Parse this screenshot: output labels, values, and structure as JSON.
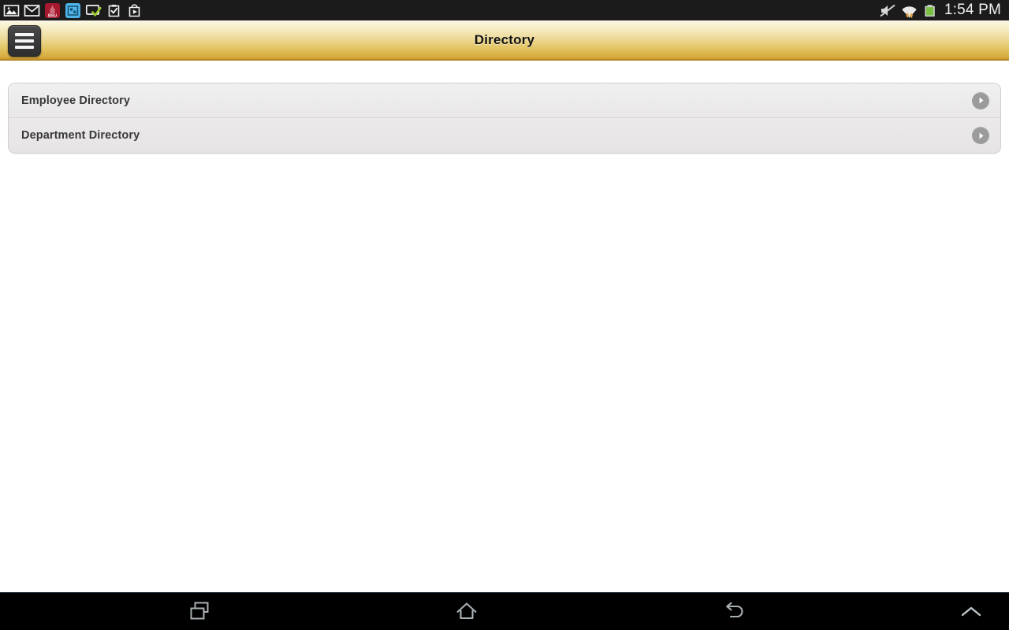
{
  "status_bar": {
    "notification_icons": [
      {
        "name": "gallery-photo-icon",
        "label": "Gallery"
      },
      {
        "name": "gmail-icon",
        "label": "Gmail"
      },
      {
        "name": "bsu-app-icon",
        "label": "BSU"
      },
      {
        "name": "screen-capture-icon",
        "label": "Screen capture"
      },
      {
        "name": "screen-check-icon",
        "label": "Screen recorder ready"
      },
      {
        "name": "clipboard-check-icon",
        "label": "Tasks complete"
      },
      {
        "name": "play-store-icon",
        "label": "Play Store"
      }
    ],
    "system_icons": [
      {
        "name": "volume-muted-icon",
        "label": "Sound muted"
      },
      {
        "name": "wifi-signal-icon",
        "label": "Wi-Fi connected"
      },
      {
        "name": "battery-icon",
        "label": "Battery"
      }
    ],
    "clock": "1:54 PM",
    "background_color": "#1b1b1b",
    "text_color": "#f2f2f2",
    "battery_color": "#7ac143"
  },
  "title_bar": {
    "title": "Directory",
    "menu_button_label": "Menu",
    "gradient_top_color": "#fcf8e7",
    "gradient_bottom_color": "#d7a93a",
    "border_color": "#b8892a",
    "title_color": "#121212"
  },
  "list": {
    "items": [
      {
        "label": "Employee Directory",
        "accessory": "chevron-right-icon"
      },
      {
        "label": "Department Directory",
        "accessory": "chevron-right-icon"
      }
    ],
    "item_text_color": "#38383a",
    "chevron_color": "#9b9b9b",
    "card_border_color": "#cfcfcf"
  },
  "page": {
    "background_color": "#ffffff"
  },
  "nav_bar": {
    "buttons": [
      {
        "name": "recents-button",
        "label": "Recent apps"
      },
      {
        "name": "home-button",
        "label": "Home"
      },
      {
        "name": "back-button",
        "label": "Back"
      },
      {
        "name": "expand-up-button",
        "label": "Show more"
      }
    ],
    "background_color": "#000000",
    "icon_color": "#a9b0b3"
  }
}
